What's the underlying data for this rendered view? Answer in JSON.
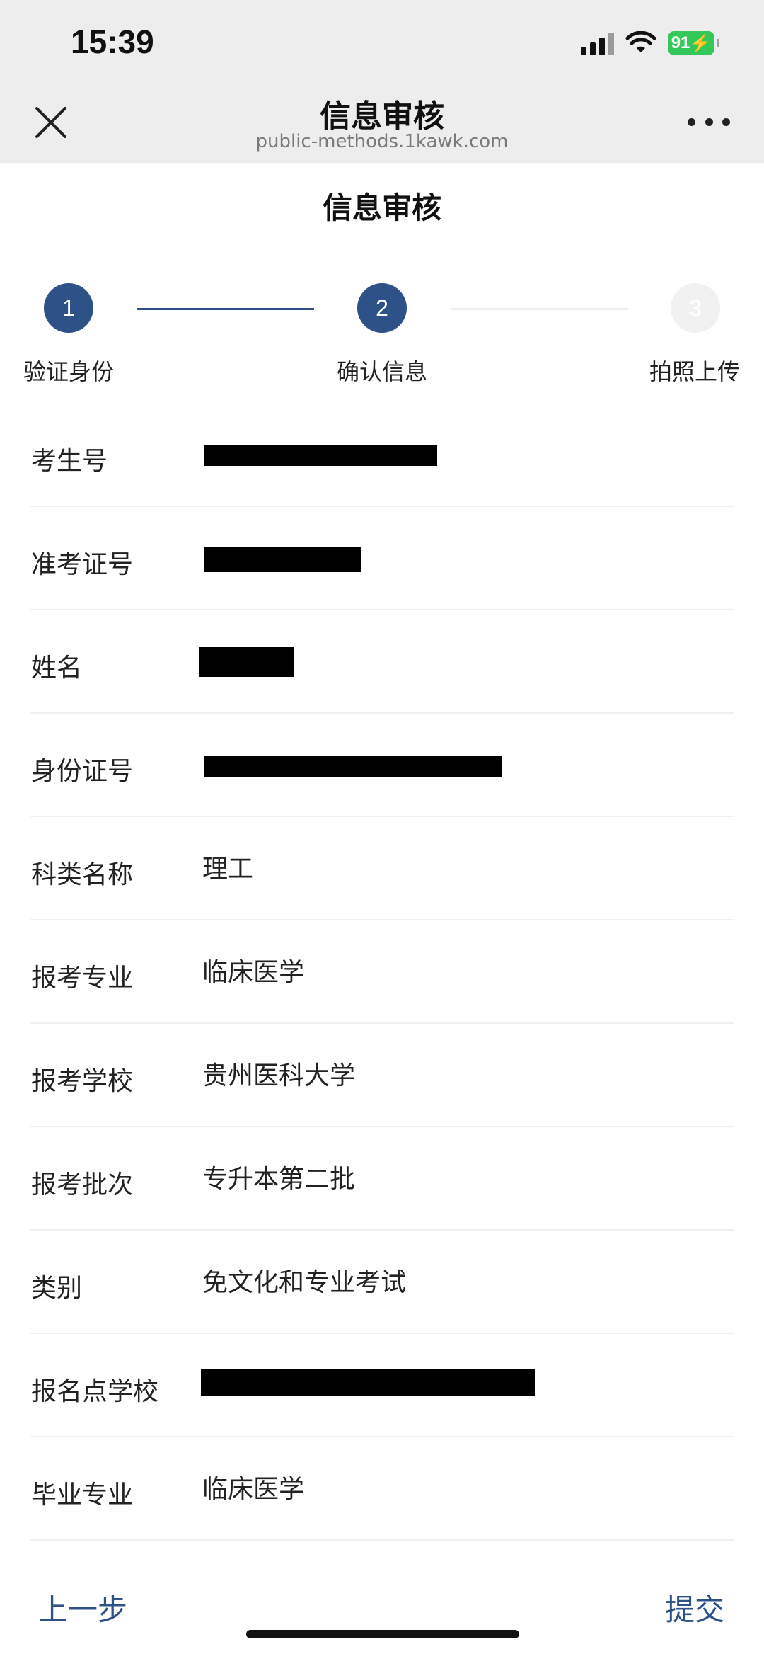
{
  "status_bar": {
    "time": "15:39",
    "battery": "91"
  },
  "nav": {
    "title": "信息审核",
    "url": "public-methods.1kawk.com"
  },
  "page": {
    "title": "信息审核"
  },
  "steps": [
    {
      "number": "1",
      "label": "验证身份",
      "state": "done"
    },
    {
      "number": "2",
      "label": "确认信息",
      "state": "active"
    },
    {
      "number": "3",
      "label": "拍照上传",
      "state": "pending"
    }
  ],
  "info": {
    "rows": [
      {
        "label": "考生号",
        "value": ""
      },
      {
        "label": "准考证号",
        "value": ""
      },
      {
        "label": "姓名",
        "value": ""
      },
      {
        "label": "身份证号",
        "value": ""
      },
      {
        "label": "科类名称",
        "value": "理工"
      },
      {
        "label": "报考专业",
        "value": "临床医学"
      },
      {
        "label": "报考学校",
        "value": "贵州医科大学"
      },
      {
        "label": "报考批次",
        "value": "专升本第二批"
      },
      {
        "label": "类别",
        "value": "免文化和专业考试"
      },
      {
        "label": "报名点学校",
        "value": ""
      },
      {
        "label": "毕业专业",
        "value": "临床医学"
      }
    ]
  },
  "footer": {
    "prev_label": "上一步",
    "submit_label": "提交"
  },
  "colors": {
    "accent": "#2e5288",
    "battery": "#34c759",
    "topbar": "#ededed"
  }
}
